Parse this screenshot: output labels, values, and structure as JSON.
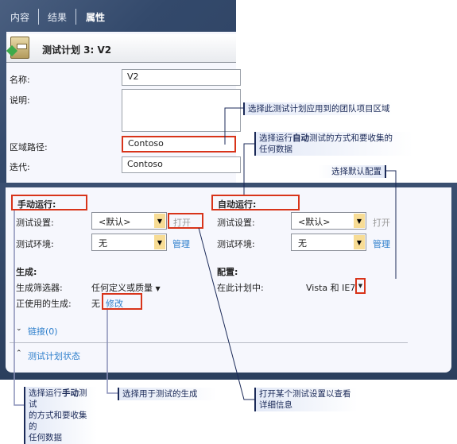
{
  "tabs": [
    {
      "label": "内容"
    },
    {
      "label": "结果"
    },
    {
      "label": "属性",
      "active": true
    }
  ],
  "plan": {
    "title": "测试计划 3: V2",
    "icon": "test-plan-icon"
  },
  "fields": {
    "name_label": "名称:",
    "name_value": "V2",
    "desc_label": "说明:",
    "desc_value": "",
    "area_label": "区域路径:",
    "area_value": "Contoso",
    "iter_label": "迭代:",
    "iter_value": "Contoso"
  },
  "manual": {
    "heading": "手动运行:",
    "settings_label": "测试设置:",
    "settings_value": "<默认>",
    "open_label": "打开",
    "env_label": "测试环境:",
    "env_value": "无",
    "manage_label": "管理"
  },
  "automated": {
    "heading": "自动运行:",
    "settings_label": "测试设置:",
    "settings_value": "<默认>",
    "open_label": "打开",
    "env_label": "测试环境:",
    "env_value": "无",
    "manage_label": "管理"
  },
  "builds": {
    "heading": "生成:",
    "filter_label": "生成筛选器:",
    "filter_value": "任何定义或质量",
    "inuse_label": "正使用的生成:",
    "inuse_value": "无",
    "modify_label": "修改"
  },
  "config": {
    "heading": "配置:",
    "inplan_label": "在此计划中:",
    "inplan_value": "Vista 和 IE7"
  },
  "links_label": "链接(0)",
  "status_label": "测试计划状态",
  "callouts": {
    "area": "选择此测试计划应用到的团队项目区域",
    "auto_pre": "选择运行",
    "auto_bold": "自动",
    "auto_line1_post": "测试的方式和要收集的",
    "auto_line2": "任何数据",
    "config": "选择默认配置",
    "manual_pre": "选择运行",
    "manual_bold": "手动",
    "manual_line1_post": "测试",
    "manual_line2": "的方式和要收集的",
    "manual_line3": "任何数据",
    "build": "选择用于测试的生成",
    "open_line1": "打开某个测试设置以查看",
    "open_line2": "详细信息"
  },
  "colors": {
    "highlight": "#d8341a",
    "link": "#2e7fcc",
    "frame": "#33496b",
    "callout_text": "#1b2a58"
  }
}
